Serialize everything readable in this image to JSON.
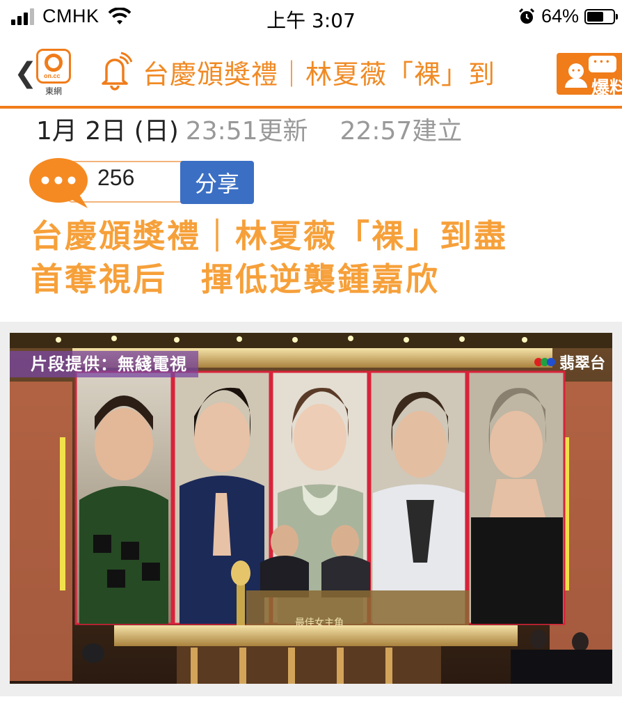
{
  "status_bar": {
    "carrier": "CMHK",
    "time": "上午 3:07",
    "battery_percent": "64%",
    "battery_level": 0.64
  },
  "nav": {
    "back_glyph": "❮",
    "logo_caption": "東網",
    "logo_text": "on.cc",
    "title": "台慶頒獎禮｜林夏薇「裸」到",
    "report_label": "爆料",
    "accent_color": "#f07c1a"
  },
  "article": {
    "date": "1月 2日 (日)",
    "updated": "23:51更新",
    "created": "22:57建立",
    "comment_count": "256",
    "share_label": "分享",
    "headline_line1": "台慶頒獎禮｜林夏薇「裸」到盡",
    "headline_line2": "首奪視后　揮低逆襲鍾嘉欣",
    "headline_color": "#f6a03a"
  },
  "photo": {
    "credit": "片段提供：無綫電視",
    "channel": "翡翠台",
    "award_caption": "最佳女主角"
  }
}
